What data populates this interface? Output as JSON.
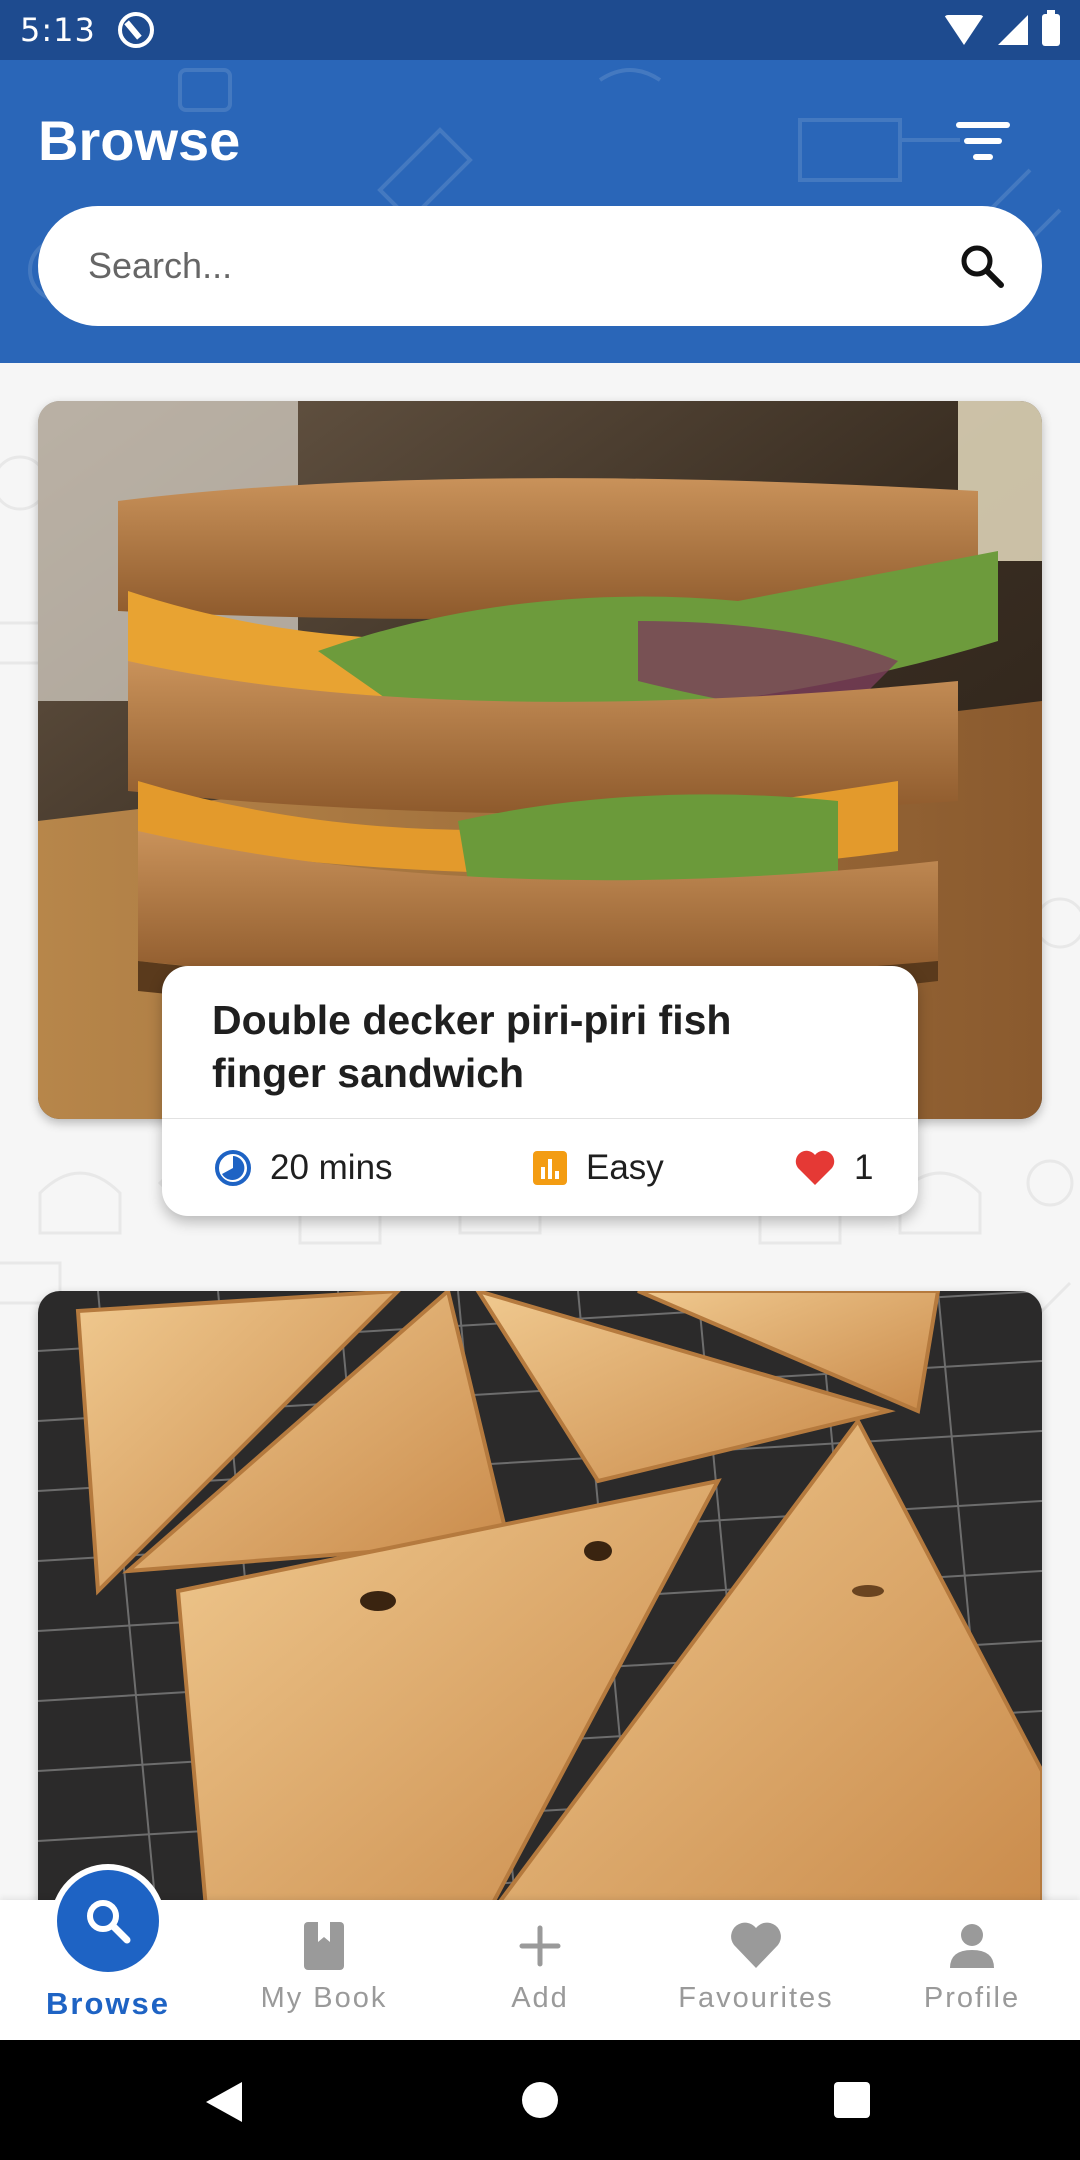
{
  "status_bar": {
    "time": "5:13"
  },
  "header": {
    "title": "Browse",
    "search_placeholder": "Search..."
  },
  "recipes": [
    {
      "title": "Double decker piri-piri fish finger sandwich",
      "time": "20 mins",
      "difficulty": "Easy",
      "likes": "1",
      "image": "sandwich-photo"
    },
    {
      "title": "",
      "image": "pastry-turnovers-photo"
    }
  ],
  "bottom_nav": {
    "items": [
      {
        "label": "Browse",
        "icon": "search-icon",
        "active": true
      },
      {
        "label": "My Book",
        "icon": "book-icon",
        "active": false
      },
      {
        "label": "Add",
        "icon": "plus-icon",
        "active": false
      },
      {
        "label": "Favourites",
        "icon": "heart-icon",
        "active": false
      },
      {
        "label": "Profile",
        "icon": "person-icon",
        "active": false
      }
    ]
  },
  "colors": {
    "primary": "#2a66b8",
    "status_bar": "#1e4b8f",
    "active_nav": "#1e63c4",
    "heart": "#e53935",
    "difficulty": "#f39c12"
  }
}
